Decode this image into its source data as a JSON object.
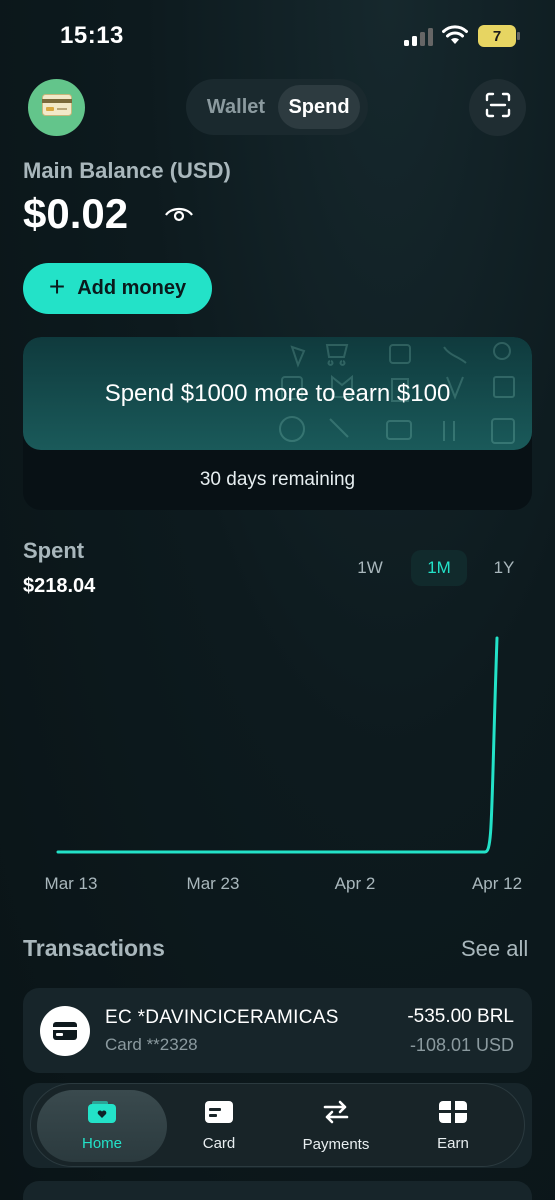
{
  "status": {
    "time": "15:13",
    "battery": "7"
  },
  "header": {
    "avatar_icon": "credit-card-icon",
    "tabs": [
      {
        "label": "Wallet",
        "active": false
      },
      {
        "label": "Spend",
        "active": true
      }
    ],
    "scan_icon": "scan-icon"
  },
  "balance": {
    "label": "Main Balance (USD)",
    "amount": "$0.02",
    "visibility_icon": "eye-icon"
  },
  "add_money": {
    "label": "Add money"
  },
  "promo": {
    "text": "Spend $1000 more to earn $100",
    "remaining": "30 days remaining"
  },
  "spent": {
    "title": "Spent",
    "amount": "$218.04",
    "periods": [
      {
        "label": "1W",
        "active": false
      },
      {
        "label": "1M",
        "active": true
      },
      {
        "label": "1Y",
        "active": false
      }
    ]
  },
  "chart_data": {
    "type": "line",
    "x_ticks": [
      "Mar 13",
      "Mar 23",
      "Apr 2",
      "Apr 12"
    ],
    "x": [
      "Mar 13",
      "Mar 23",
      "Apr 2",
      "Apr 10",
      "Apr 11",
      "Apr 12"
    ],
    "y": [
      0,
      0,
      0,
      0,
      0,
      218.04
    ],
    "ylim": [
      0,
      218.04
    ],
    "color": "#23e2c8"
  },
  "transactions": {
    "title": "Transactions",
    "see_all": "See all",
    "items": [
      {
        "merchant": "EC *DAVINCICERAMICAS",
        "card": "Card **2328",
        "amount_local": "-535.00 BRL",
        "amount_usd": "-108.01 USD",
        "icon": "wallet-card-icon"
      }
    ]
  },
  "nav": {
    "items": [
      {
        "label": "Home",
        "icon": "home-wallet-icon",
        "active": true
      },
      {
        "label": "Card",
        "icon": "card-icon",
        "active": false
      },
      {
        "label": "Payments",
        "icon": "transfer-arrows-icon",
        "active": false
      },
      {
        "label": "Earn",
        "icon": "gift-icon",
        "active": false
      }
    ]
  }
}
